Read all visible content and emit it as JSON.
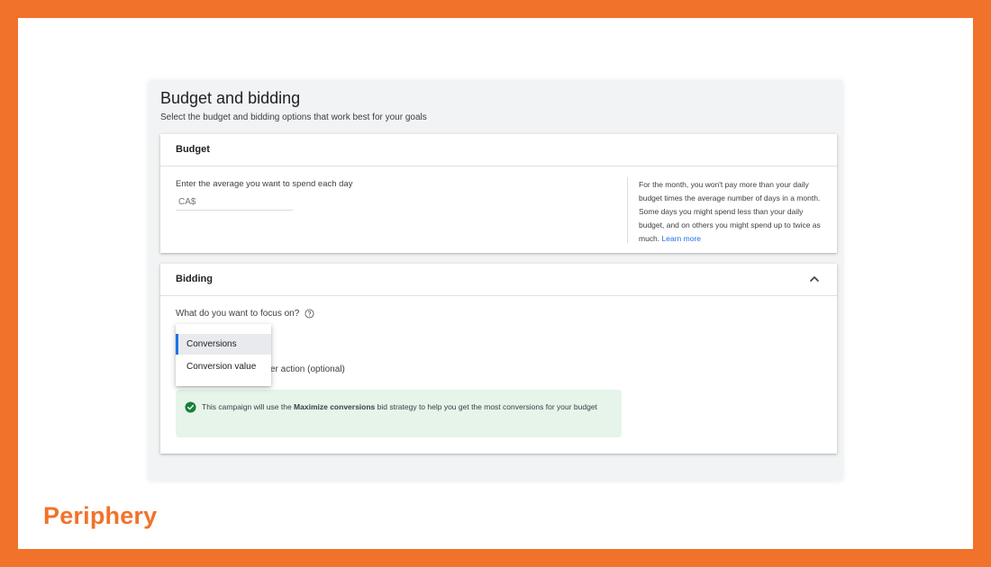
{
  "page": {
    "title": "Budget and bidding",
    "subtitle": "Select the budget and bidding options that work best for your goals"
  },
  "budget": {
    "card_title": "Budget",
    "input_label": "Enter the average you want to spend each day",
    "currency_placeholder": "CA$",
    "help_text": "For the month, you won't pay more than your daily budget times the average number of days in a month. Some days you might spend less than your daily budget, and on others you might spend up to twice as much.",
    "learn_more_label": "Learn more"
  },
  "bidding": {
    "card_title": "Bidding",
    "focus_question": "What do you want to focus on?",
    "dropdown_options": [
      "Conversions",
      "Conversion value"
    ],
    "selected_option": "Conversions",
    "partially_hidden_text": "er action (optional)",
    "info": {
      "prefix": "This campaign will use the ",
      "strategy": "Maximize conversions",
      "suffix": " bid strategy to help you get the most conversions for your budget"
    }
  },
  "brand": {
    "logo_text": "Periphery"
  },
  "colors": {
    "background_orange": "#f1722b",
    "accent_blue": "#1a73e8",
    "success_green": "#188038",
    "info_bg": "#e6f4ea"
  },
  "icons": {
    "collapse": "chevron-up-icon",
    "help": "help-circle-icon",
    "success": "check-circle-icon"
  }
}
